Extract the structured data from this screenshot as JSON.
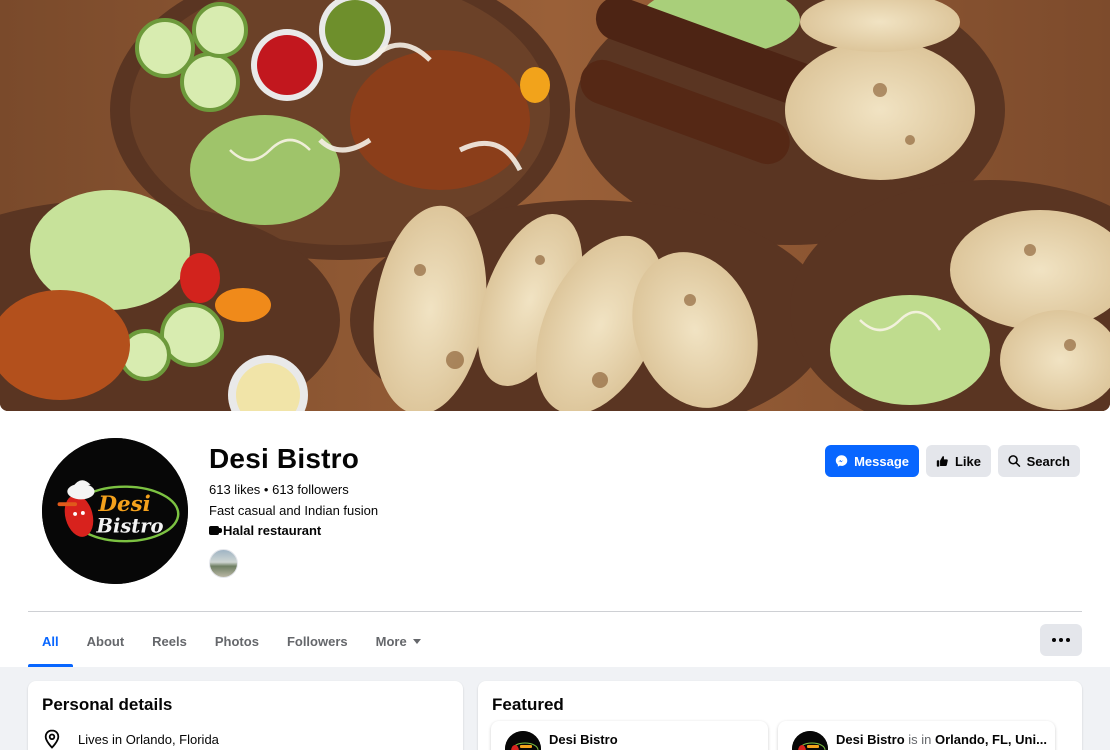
{
  "cover": {
    "alt": ""
  },
  "page": {
    "name": "Desi Bistro",
    "likes": "613 likes",
    "separator": " • ",
    "followers": "613 followers",
    "tagline": "Fast casual and Indian fusion",
    "category": "Halal restaurant",
    "logo_text_1": "Desi",
    "logo_text_2": "Bistro"
  },
  "actions": {
    "message_label": "Message",
    "like_label": "Like",
    "search_label": "Search"
  },
  "tabs": [
    {
      "label": "All",
      "active": true
    },
    {
      "label": "About"
    },
    {
      "label": "Reels"
    },
    {
      "label": "Photos"
    },
    {
      "label": "Followers"
    },
    {
      "label": "More"
    }
  ],
  "personal_details": {
    "title": "Personal details",
    "location": "Lives in Orlando, Florida"
  },
  "featured": {
    "title": "Featured",
    "items": [
      {
        "name": "Desi Bistro",
        "rest": "",
        "place": ""
      },
      {
        "name": "Desi Bistro",
        "rest": " is in ",
        "place": "Orlando, FL, Uni..."
      }
    ]
  },
  "colors": {
    "accent": "#0866ff",
    "secondary_button": "#e4e6eb",
    "page_bg": "#f0f2f5"
  },
  "icons": {
    "message": "messenger-icon",
    "like": "thumbs-up-icon",
    "search": "search-icon",
    "location": "location-pin-icon",
    "more": "ellipsis-icon"
  }
}
